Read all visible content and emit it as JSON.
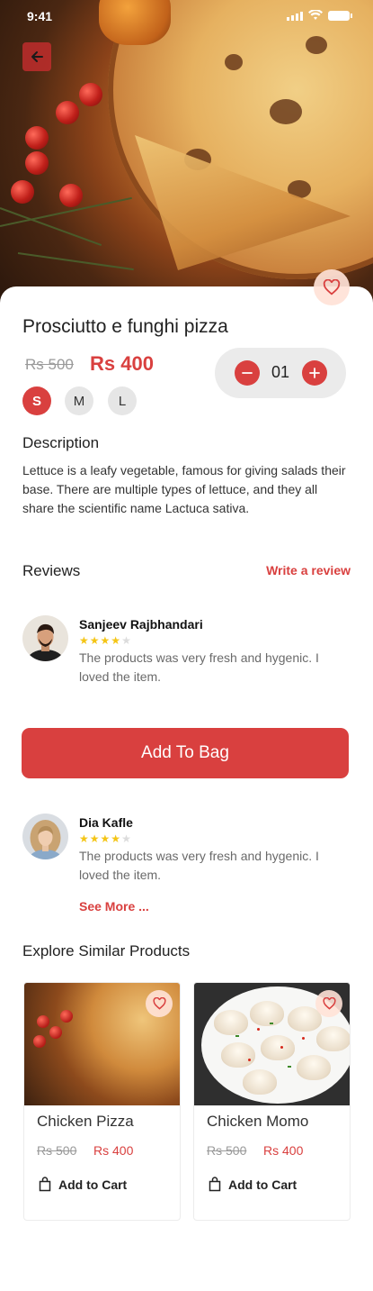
{
  "status_bar": {
    "time": "9:41"
  },
  "product": {
    "title": "Prosciutto e funghi pizza",
    "old_price": "Rs 500",
    "new_price": "Rs 400",
    "sizes": [
      "S",
      "M",
      "L"
    ],
    "selected_size": "S",
    "quantity": "01"
  },
  "description": {
    "heading": "Description",
    "text": "Lettuce is a leafy vegetable, famous for giving salads their base. There are multiple types of lettuce, and they all share the scientific name Lactuca sativa."
  },
  "reviews": {
    "heading": "Reviews",
    "write_review_label": "Write a review",
    "items": [
      {
        "name": "Sanjeev Rajbhandari",
        "rating": 4,
        "max_rating": 5,
        "text": "The products was very fresh and hygenic. I loved the item."
      },
      {
        "name": "Dia Kafle",
        "rating": 4,
        "max_rating": 5,
        "text": "The products was very fresh and hygenic. I loved the item."
      }
    ],
    "see_more_label": "See More ..."
  },
  "actions": {
    "add_to_bag_label": "Add To Bag"
  },
  "similar": {
    "heading": "Explore Similar Products",
    "items": [
      {
        "name": "Chicken Pizza",
        "old_price": "Rs 500",
        "new_price": "Rs 400",
        "cart_label": "Add to Cart"
      },
      {
        "name": "Chicken Momo",
        "old_price": "Rs 500",
        "new_price": "Rs 400",
        "cart_label": "Add to Cart"
      }
    ]
  },
  "colors": {
    "accent": "#d9403f",
    "star": "#f4c516",
    "favorite_bg": "#ffe2d7"
  },
  "icons": [
    "back-arrow-icon",
    "heart-icon",
    "minus-icon",
    "plus-icon",
    "star-icon",
    "shopping-bag-icon",
    "signal-icon",
    "wifi-icon",
    "battery-icon"
  ]
}
